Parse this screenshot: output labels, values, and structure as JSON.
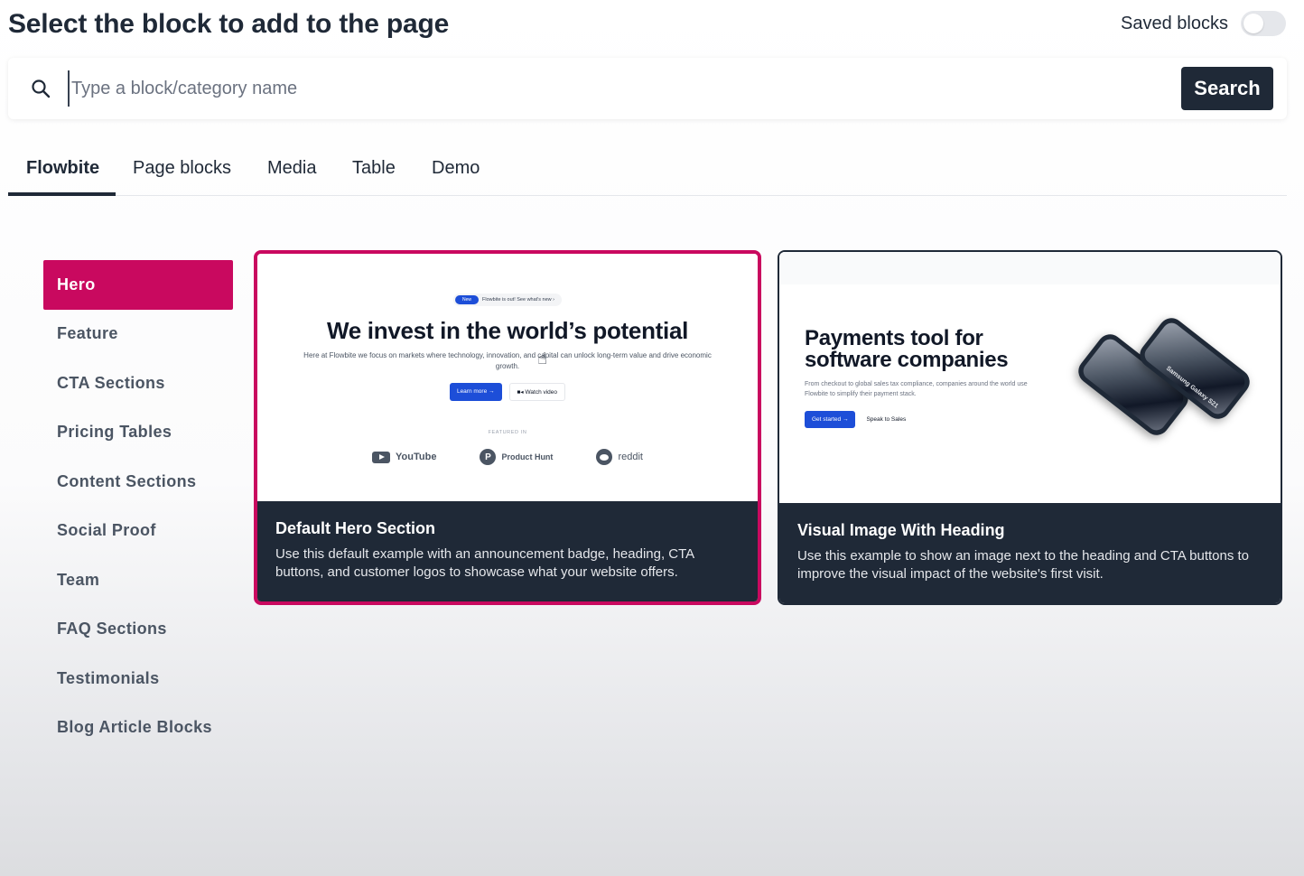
{
  "header": {
    "title": "Select the block to add to the page",
    "saved_blocks_label": "Saved blocks",
    "saved_blocks_enabled": false
  },
  "search": {
    "placeholder": "Type a block/category name",
    "value": "",
    "button_label": "Search"
  },
  "tabs": [
    {
      "label": "Flowbite",
      "active": true
    },
    {
      "label": "Page blocks",
      "active": false
    },
    {
      "label": "Media",
      "active": false
    },
    {
      "label": "Table",
      "active": false
    },
    {
      "label": "Demo",
      "active": false
    }
  ],
  "sidebar": {
    "items": [
      {
        "label": "Hero",
        "active": true
      },
      {
        "label": "Feature"
      },
      {
        "label": "CTA Sections"
      },
      {
        "label": "Pricing Tables"
      },
      {
        "label": "Content Sections"
      },
      {
        "label": "Social Proof"
      },
      {
        "label": "Team"
      },
      {
        "label": "FAQ Sections"
      },
      {
        "label": "Testimonials"
      },
      {
        "label": "Blog Article Blocks"
      }
    ]
  },
  "cards": [
    {
      "title": "Default Hero Section",
      "description": "Use this default example with an announcement badge, heading, CTA buttons, and customer logos to showcase what your website offers.",
      "selected": true,
      "preview": {
        "badge_new": "New",
        "badge_text": "Flowbite is out! See what's new  ›",
        "heading": "We invest in the world’s potential",
        "subtext": "Here at Flowbite we focus on markets where technology, innovation, and capital can unlock long-term value and drive economic growth.",
        "primary_button": "Learn more →",
        "secondary_button": "Watch video",
        "featured_label": "FEATURED IN",
        "logos": [
          "YouTube",
          "Product Hunt",
          "reddit"
        ]
      }
    },
    {
      "title": "Visual Image With Heading",
      "description": "Use this example to show an image next to the heading and CTA buttons to improve the visual impact of the website's first visit.",
      "selected": false,
      "preview": {
        "heading_line1": "Payments tool for",
        "heading_line2": "software companies",
        "subtext": "From checkout to global sales tax compliance, companies around the world use Flowbite to simplify their payment stack.",
        "primary_button": "Get started →",
        "secondary_button": "Speak to Sales",
        "phone_label": "Samsung Galaxy S21"
      }
    }
  ],
  "colors": {
    "accent": "#c9095f",
    "dark": "#1f2937",
    "mini_primary": "#1d4ed8"
  }
}
